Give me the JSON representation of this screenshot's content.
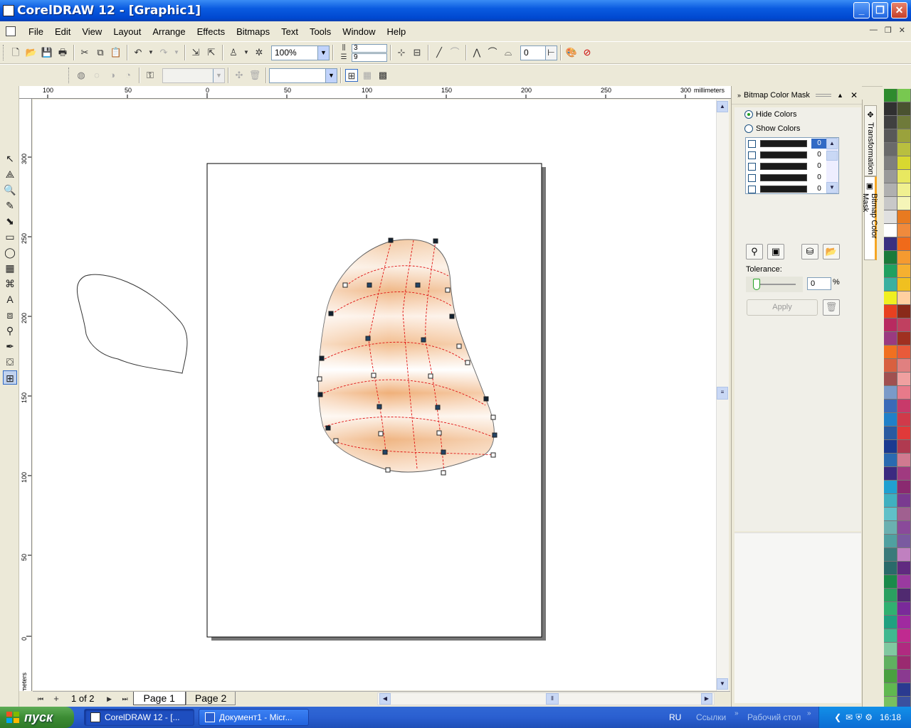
{
  "window": {
    "title": "CorelDRAW 12 - [Graphic1]"
  },
  "menu": [
    "File",
    "Edit",
    "View",
    "Layout",
    "Arrange",
    "Effects",
    "Bitmaps",
    "Text",
    "Tools",
    "Window",
    "Help"
  ],
  "toolbar": {
    "zoom": "100%",
    "rows": "3",
    "cols": "9",
    "smoothness": "0"
  },
  "rulers": {
    "unit": "millimeters",
    "h_ticks": [
      "100",
      "50",
      "0",
      "50",
      "100",
      "150",
      "200",
      "250",
      "300"
    ],
    "v_ticks": [
      "300",
      "250",
      "200",
      "150",
      "100",
      "50",
      "0"
    ]
  },
  "pages": {
    "counter": "1 of 2",
    "tabs": [
      "Page 1",
      "Page 2"
    ]
  },
  "docker": {
    "title": "Bitmap Color Mask",
    "hide_colors": "Hide Colors",
    "show_colors": "Show Colors",
    "rows": [
      {
        "value": "0"
      },
      {
        "value": "0"
      },
      {
        "value": "0"
      },
      {
        "value": "0"
      },
      {
        "value": "0"
      }
    ],
    "tolerance_label": "Tolerance:",
    "tolerance_value": "0",
    "tolerance_unit": "%",
    "apply": "Apply"
  },
  "side_tabs": [
    "Transformation",
    "Bitmap Color Mask"
  ],
  "palette_colors": [
    "#2e8b2e",
    "#78c850",
    "#303030",
    "#4a5230",
    "#404040",
    "#6f7a3a",
    "#585858",
    "#9aa23c",
    "#6a6a6a",
    "#b9bf3f",
    "#7f7f7f",
    "#d8d830",
    "#999999",
    "#e8e860",
    "#b0b0b0",
    "#f0f090",
    "#c8c8c8",
    "#f5f5b8",
    "#e0e0e0",
    "#e87a20",
    "#ffffff",
    "#f08a3c",
    "#3a3080",
    "#f06a1a",
    "#1a7a3a",
    "#f59a30",
    "#20a060",
    "#f5b030",
    "#3ab0a0",
    "#f0c020",
    "#f0f020",
    "#ffd0a0",
    "#e84020",
    "#8a2a1a",
    "#b82a60",
    "#c04060",
    "#9a3a80",
    "#a03020",
    "#f07020",
    "#e85a3a",
    "#d86040",
    "#e08080",
    "#a05050",
    "#f0a0a0",
    "#7a9ac8",
    "#e87a8a",
    "#3a6ab8",
    "#c83a6a",
    "#2080c8",
    "#d03a4a",
    "#2a5aa0",
    "#e03a3a",
    "#1a3a90",
    "#b03a50",
    "#2a6ab0",
    "#d07a90",
    "#3a2a80",
    "#a03a80",
    "#20a0d0",
    "#8a2a70",
    "#40b0c0",
    "#7a3a90",
    "#60c0c8",
    "#a06090",
    "#6ab0b0",
    "#8a4a9a",
    "#50a0a0",
    "#7a5aa0",
    "#3a7a7a",
    "#c080c0",
    "#2a6a6a",
    "#602a80",
    "#1a8a4a",
    "#9a3aa0",
    "#2aa060",
    "#502a70",
    "#30b070",
    "#7a2a9a",
    "#20a080",
    "#a02aa0",
    "#40b890",
    "#c02a90",
    "#80c8a0",
    "#b02a80",
    "#60b060",
    "#9a2a70",
    "#4aa040",
    "#8a3a90",
    "#60b850",
    "#2a3a90",
    "#78c060",
    "#3a50a0"
  ],
  "taskbar": {
    "start": "пуск",
    "tasks": [
      "CorelDRAW 12 - [...",
      "Документ1 - Micr..."
    ],
    "lang": "RU",
    "links": "Ссылки",
    "desktop": "Рабочий стол",
    "clock": "16:18"
  }
}
